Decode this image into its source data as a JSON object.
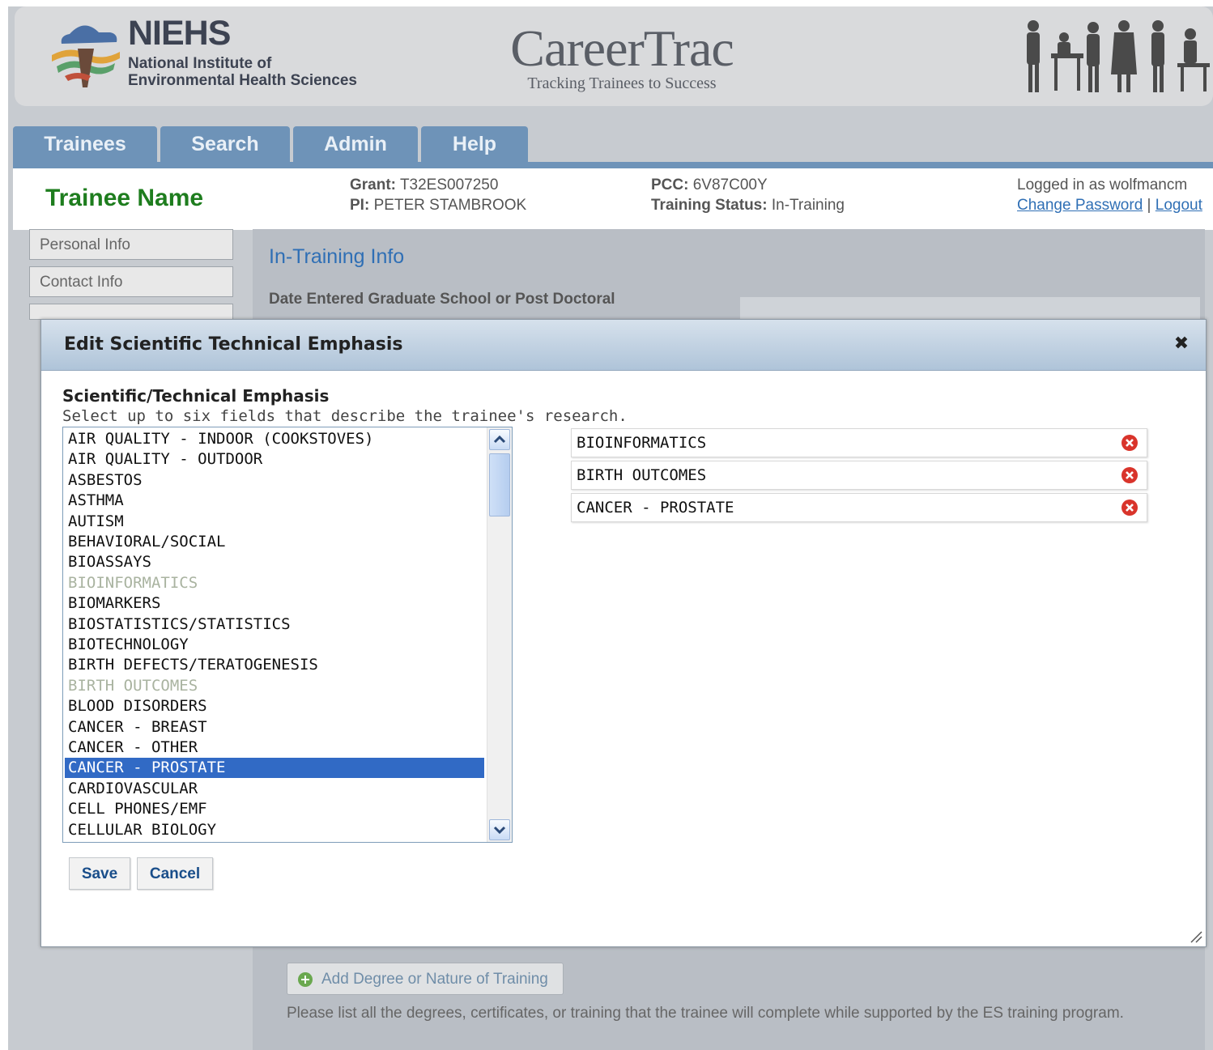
{
  "header": {
    "org_short": "NIEHS",
    "org_line1": "National Institute of",
    "org_line2": "Environmental Health Sciences",
    "app_title": "CareerTrac",
    "app_tagline": "Tracking Trainees to Success"
  },
  "tabs": [
    {
      "label": "Trainees"
    },
    {
      "label": "Search"
    },
    {
      "label": "Admin"
    },
    {
      "label": "Help"
    }
  ],
  "trainee": {
    "name": "Trainee Name",
    "grant_label": "Grant:",
    "grant_value": "T32ES007250",
    "pi_label": "PI:",
    "pi_value": "PETER STAMBROOK",
    "pcc_label": "PCC:",
    "pcc_value": "6V87C00Y",
    "status_label": "Training Status:",
    "status_value": "In-Training",
    "logged_in": "Logged in as wolfmancm",
    "change_password": "Change Password",
    "separator": "|",
    "logout": "Logout"
  },
  "left_nav": [
    {
      "label": "Personal Info"
    },
    {
      "label": "Contact Info"
    }
  ],
  "content": {
    "title": "In-Training Info",
    "date_label": "Date Entered Graduate School or Post Doctoral",
    "add_degree_button": "Add Degree or Nature of Training",
    "hint": "Please list all the degrees, certificates, or training that the trainee will complete while supported by the ES training program."
  },
  "dialog": {
    "title": "Edit Scientific Technical Emphasis",
    "field_label": "Scientific/Technical Emphasis",
    "field_help": "Select up to six fields that describe the trainee's research.",
    "options": [
      {
        "label": "AIR QUALITY - INDOOR (COOKSTOVES)",
        "state": "normal"
      },
      {
        "label": "AIR QUALITY - OUTDOOR",
        "state": "normal"
      },
      {
        "label": "ASBESTOS",
        "state": "normal"
      },
      {
        "label": "ASTHMA",
        "state": "normal"
      },
      {
        "label": "AUTISM",
        "state": "normal"
      },
      {
        "label": "BEHAVIORAL/SOCIAL",
        "state": "normal"
      },
      {
        "label": "BIOASSAYS",
        "state": "normal"
      },
      {
        "label": "BIOINFORMATICS",
        "state": "disabled"
      },
      {
        "label": "BIOMARKERS",
        "state": "normal"
      },
      {
        "label": "BIOSTATISTICS/STATISTICS",
        "state": "normal"
      },
      {
        "label": "BIOTECHNOLOGY",
        "state": "normal"
      },
      {
        "label": "BIRTH DEFECTS/TERATOGENESIS",
        "state": "normal"
      },
      {
        "label": "BIRTH OUTCOMES",
        "state": "disabled"
      },
      {
        "label": "BLOOD DISORDERS",
        "state": "normal"
      },
      {
        "label": "CANCER - BREAST",
        "state": "normal"
      },
      {
        "label": "CANCER - OTHER",
        "state": "normal"
      },
      {
        "label": "CANCER - PROSTATE",
        "state": "selected"
      },
      {
        "label": "CARDIOVASCULAR",
        "state": "normal"
      },
      {
        "label": "CELL PHONES/EMF",
        "state": "normal"
      },
      {
        "label": "CELLULAR BIOLOGY",
        "state": "normal"
      }
    ],
    "selected_items": [
      {
        "label": "BIOINFORMATICS"
      },
      {
        "label": "BIRTH OUTCOMES"
      },
      {
        "label": "CANCER - PROSTATE"
      }
    ],
    "save_label": "Save",
    "cancel_label": "Cancel",
    "close_glyph": "✖"
  },
  "colors": {
    "tab_blue": "#6e93b8",
    "trainee_green": "#1e7d1e",
    "link_blue": "#2f6fb5",
    "selection_blue": "#316ac5",
    "remove_red": "#d9342b"
  }
}
